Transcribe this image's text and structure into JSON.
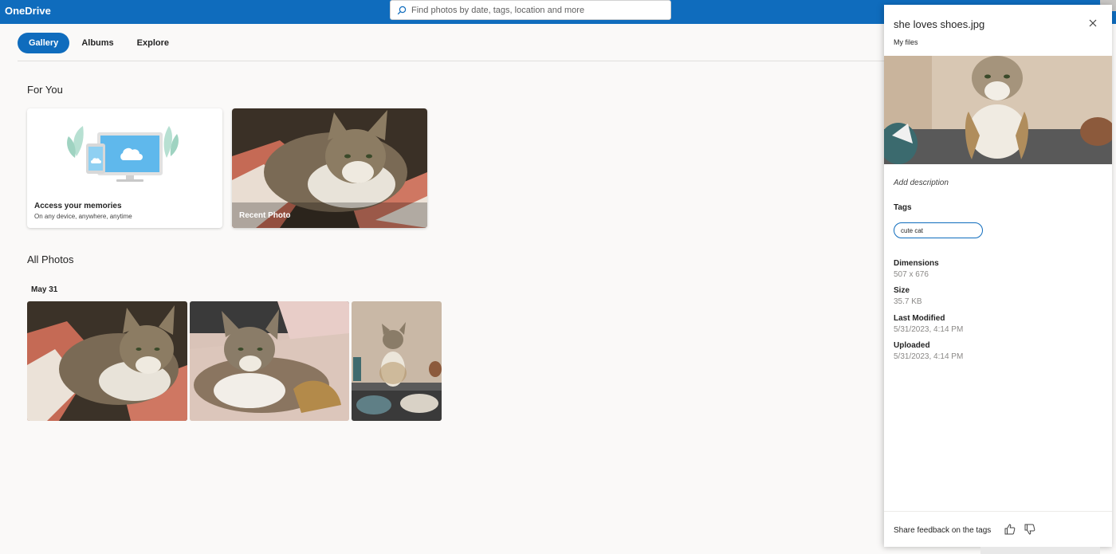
{
  "app": {
    "brand": "OneDrive"
  },
  "search": {
    "placeholder": "Find photos by date, tags, location and more"
  },
  "tabs": [
    {
      "label": "Gallery",
      "active": true
    },
    {
      "label": "Albums",
      "active": false
    },
    {
      "label": "Explore",
      "active": false
    }
  ],
  "for_you": {
    "title": "For You",
    "memories_card": {
      "title": "Access your memories",
      "subtitle": "On any device, anywhere, anytime"
    },
    "recent_card": {
      "label": "Recent Photo"
    }
  },
  "all_photos": {
    "title": "All Photos",
    "date_group": "May 31"
  },
  "panel": {
    "file_name": "she loves shoes.jpg",
    "location": "My files",
    "description_placeholder": "Add description",
    "tags_label": "Tags",
    "tag_value": "cute cat",
    "dimensions_label": "Dimensions",
    "dimensions_value": "507 x 676",
    "size_label": "Size",
    "size_value": "35.7 KB",
    "modified_label": "Last Modified",
    "modified_value": "5/31/2023, 4:14 PM",
    "uploaded_label": "Uploaded",
    "uploaded_value": "5/31/2023, 4:14 PM",
    "feedback_text": "Share feedback on the tags"
  },
  "icons": {
    "search": "search-icon",
    "close": "close-icon",
    "thumbs_up": "thumbs-up-icon",
    "thumbs_down": "thumbs-down-icon"
  },
  "colors": {
    "accent": "#0f6cbd",
    "background": "#faf9f8"
  }
}
